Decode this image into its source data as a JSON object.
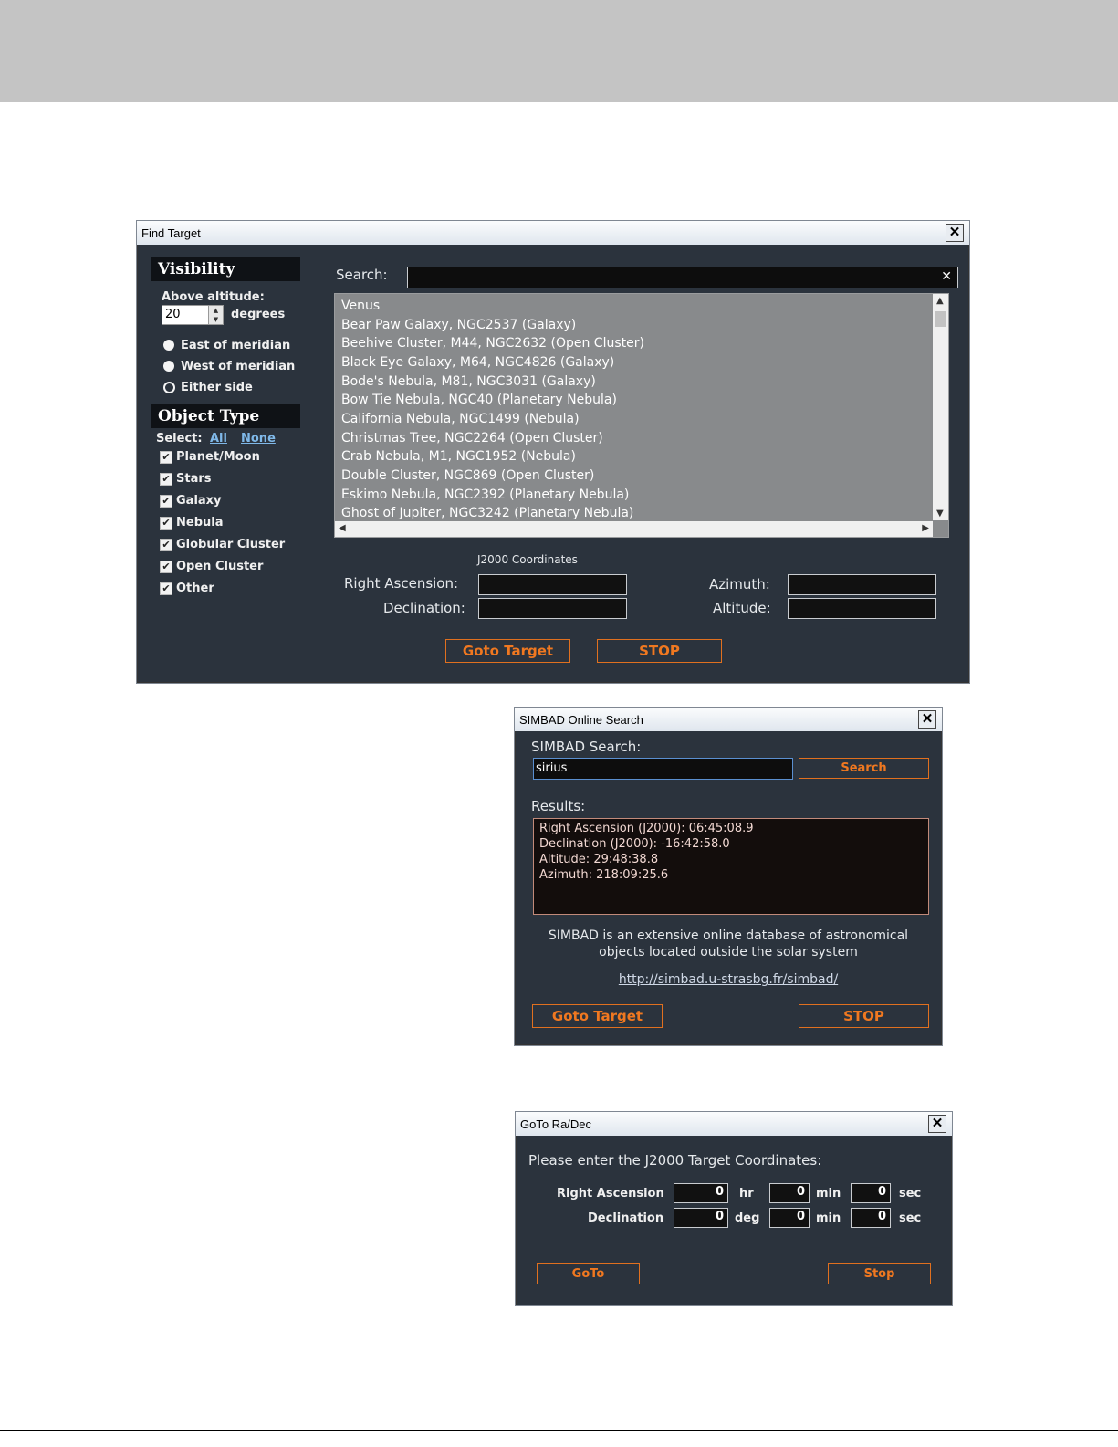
{
  "find_target": {
    "title": "Find Target",
    "close": "✕",
    "visibility_header": "Visibility",
    "above_altitude_label": "Above altitude:",
    "altitude_value": "20",
    "degrees_label": "degrees",
    "radios": [
      "East of meridian",
      "West of meridian",
      "Either side"
    ],
    "object_type_header": "Object Type",
    "select_label": "Select:",
    "select_all": "All",
    "select_none": "None",
    "object_types": [
      "Planet/Moon",
      "Stars",
      "Galaxy",
      "Nebula",
      "Globular Cluster",
      "Open Cluster",
      "Other"
    ],
    "check_glyph": "✔",
    "search_label": "Search:",
    "search_clear": "✕",
    "targets": [
      "Venus",
      "Bear Paw Galaxy, NGC2537 (Galaxy)",
      "Beehive Cluster, M44, NGC2632 (Open Cluster)",
      "Black Eye Galaxy, M64, NGC4826 (Galaxy)",
      "Bode's Nebula, M81, NGC3031 (Galaxy)",
      "Bow Tie Nebula, NGC40 (Planetary Nebula)",
      "California Nebula, NGC1499 (Nebula)",
      "Christmas Tree, NGC2264 (Open Cluster)",
      "Crab Nebula, M1, NGC1952 (Nebula)",
      "Double Cluster, NGC869 (Open Cluster)",
      "Eskimo Nebula, NGC2392 (Planetary Nebula)",
      "Ghost of Jupiter, NGC3242 (Planetary Nebula)"
    ],
    "coords_caption": "J2000 Coordinates",
    "ra_label": "Right Ascension:",
    "dec_label": "Declination:",
    "az_label": "Azimuth:",
    "alt_label": "Altitude:",
    "goto_button": "Goto Target",
    "stop_button": "STOP"
  },
  "simbad": {
    "title": "SIMBAD Online Search",
    "close": "✕",
    "search_label": "SIMBAD Search:",
    "search_value": "sirius",
    "search_button": "Search",
    "results_label": "Results:",
    "results": [
      "Right Ascension (J2000): 06:45:08.9",
      "Declination (J2000): -16:42:58.0",
      "Altitude: 29:48:38.8",
      "Azimuth: 218:09:25.6"
    ],
    "description_line1": "SIMBAD is an extensive online database of astronomical",
    "description_line2": "objects located outside the solar system",
    "link": "http://simbad.u-strasbg.fr/simbad/",
    "goto_button": "Goto Target",
    "stop_button": "STOP"
  },
  "goto_radec": {
    "title": "GoTo Ra/Dec",
    "close": "✕",
    "prompt": "Please enter the J2000 Target Coordinates:",
    "ra_label": "Right Ascension",
    "dec_label": "Declination",
    "ra_values": [
      "0",
      "0",
      "0"
    ],
    "dec_values": [
      "0",
      "0",
      "0"
    ],
    "unit_hr": "hr",
    "unit_deg": "deg",
    "unit_min": "min",
    "unit_sec": "sec",
    "goto_button": "GoTo",
    "stop_button": "Stop"
  }
}
